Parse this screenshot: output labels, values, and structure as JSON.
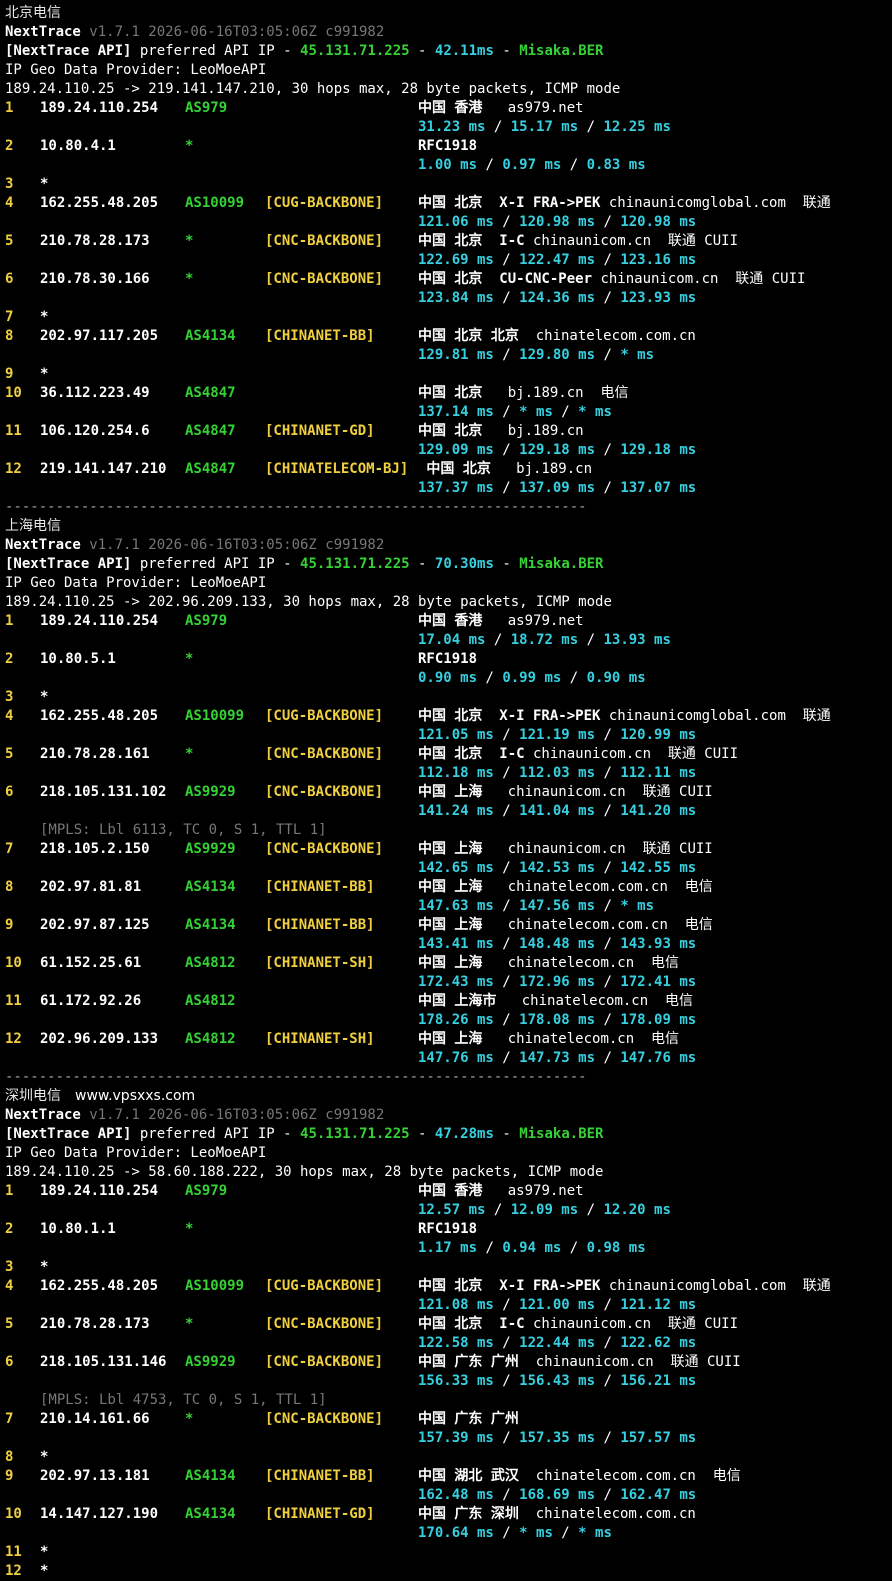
{
  "watermark": "www.vpsxxs.com",
  "sections": [
    {
      "title": "北京电信",
      "nt_name": "NextTrace",
      "nt_version": "v1.7.1 2026-06-16T03:05:06Z c991982",
      "api_label": "[NextTrace API]",
      "api_text": " preferred API IP - ",
      "api_ip": "45.131.71.225",
      "api_dash1": " - ",
      "api_ms": "42.11ms",
      "api_dash2": " - ",
      "api_node": "Misaka.BER",
      "geo_provider": "IP Geo Data Provider: LeoMoeAPI",
      "route_line": "189.24.110.25 -> 219.141.147.210, 30 hops max, 28 byte packets, ICMP mode",
      "hops": [
        {
          "ttl": "1",
          "ip": "189.24.110.254",
          "asn": "AS979",
          "tag": "",
          "geo_b": "中国 香港",
          "host": "   as979.net",
          "lat": [
            "31.23 ms",
            "15.17 ms",
            "12.25 ms"
          ]
        },
        {
          "ttl": "2",
          "ip": "10.80.4.1",
          "asn": "*",
          "tag": "",
          "geo_b": "RFC1918",
          "host": "",
          "lat": [
            "1.00 ms",
            "0.97 ms",
            "0.83 ms"
          ]
        },
        {
          "ttl": "3",
          "ip": "*",
          "star": true
        },
        {
          "ttl": "4",
          "ip": "162.255.48.205",
          "asn": "AS10099",
          "tag": "[CUG-BACKBONE]",
          "geo_b": "中国 北京  X-I FRA->PEK",
          "host": " chinaunicomglobal.com  联通",
          "lat": [
            "121.06 ms",
            "120.98 ms",
            "120.98 ms"
          ]
        },
        {
          "ttl": "5",
          "ip": "210.78.28.173",
          "asn": "*",
          "tag": "[CNC-BACKBONE]",
          "geo_b": "中国 北京  I-C",
          "host": " chinaunicom.cn  联通 CUII",
          "lat": [
            "122.69 ms",
            "122.47 ms",
            "123.16 ms"
          ]
        },
        {
          "ttl": "6",
          "ip": "210.78.30.166",
          "asn": "*",
          "tag": "[CNC-BACKBONE]",
          "geo_b": "中国 北京  CU-CNC-Peer",
          "host": " chinaunicom.cn  联通 CUII",
          "lat": [
            "123.84 ms",
            "124.36 ms",
            "123.93 ms"
          ]
        },
        {
          "ttl": "7",
          "ip": "*",
          "star": true
        },
        {
          "ttl": "8",
          "ip": "202.97.117.205",
          "asn": "AS4134",
          "tag": "[CHINANET-BB]",
          "geo_b": "中国 北京 北京",
          "host": "  chinatelecom.com.cn",
          "lat": [
            "129.81 ms",
            "129.80 ms",
            "* ms"
          ]
        },
        {
          "ttl": "9",
          "ip": "*",
          "star": true
        },
        {
          "ttl": "10",
          "ip": "36.112.223.49",
          "asn": "AS4847",
          "tag": "",
          "geo_b": "中国 北京",
          "host": "   bj.189.cn  电信",
          "lat": [
            "137.14 ms",
            "* ms",
            "* ms"
          ]
        },
        {
          "ttl": "11",
          "ip": "106.120.254.6",
          "asn": "AS4847",
          "tag": "[CHINANET-GD]",
          "geo_b": "中国 北京",
          "host": "   bj.189.cn",
          "lat": [
            "129.09 ms",
            "129.18 ms",
            "129.18 ms"
          ]
        },
        {
          "ttl": "12",
          "ip": "219.141.147.210",
          "asn": "AS4847",
          "tag": "[CHINATELECOM-BJ]",
          "geo_b": " 中国 北京",
          "host": "   bj.189.cn",
          "lat": [
            "137.37 ms",
            "137.09 ms",
            "137.07 ms"
          ]
        }
      ]
    },
    {
      "title": "上海电信",
      "nt_name": "NextTrace",
      "nt_version": "v1.7.1 2026-06-16T03:05:06Z c991982",
      "api_label": "[NextTrace API]",
      "api_text": " preferred API IP - ",
      "api_ip": "45.131.71.225",
      "api_dash1": " - ",
      "api_ms": "70.30ms",
      "api_dash2": " - ",
      "api_node": "Misaka.BER",
      "geo_provider": "IP Geo Data Provider: LeoMoeAPI",
      "route_line": "189.24.110.25 -> 202.96.209.133, 30 hops max, 28 byte packets, ICMP mode",
      "hops": [
        {
          "ttl": "1",
          "ip": "189.24.110.254",
          "asn": "AS979",
          "tag": "",
          "geo_b": "中国 香港",
          "host": "   as979.net",
          "lat": [
            "17.04 ms",
            "18.72 ms",
            "13.93 ms"
          ]
        },
        {
          "ttl": "2",
          "ip": "10.80.5.1",
          "asn": "*",
          "tag": "",
          "geo_b": "RFC1918",
          "host": "",
          "lat": [
            "0.90 ms",
            "0.99 ms",
            "0.90 ms"
          ]
        },
        {
          "ttl": "3",
          "ip": "*",
          "star": true
        },
        {
          "ttl": "4",
          "ip": "162.255.48.205",
          "asn": "AS10099",
          "tag": "[CUG-BACKBONE]",
          "geo_b": "中国 北京  X-I FRA->PEK",
          "host": " chinaunicomglobal.com  联通",
          "lat": [
            "121.05 ms",
            "121.19 ms",
            "120.99 ms"
          ]
        },
        {
          "ttl": "5",
          "ip": "210.78.28.161",
          "asn": "*",
          "tag": "[CNC-BACKBONE]",
          "geo_b": "中国 北京  I-C",
          "host": " chinaunicom.cn  联通 CUII",
          "lat": [
            "112.18 ms",
            "112.03 ms",
            "112.11 ms"
          ]
        },
        {
          "ttl": "6",
          "ip": "218.105.131.102",
          "asn": "AS9929",
          "tag": "[CNC-BACKBONE]",
          "geo_b": "中国 上海",
          "host": "   chinaunicom.cn  联通 CUII",
          "lat": [
            "141.24 ms",
            "141.04 ms",
            "141.20 ms"
          ],
          "mpls": "[MPLS: Lbl 6113, TC 0, S 1, TTL 1]"
        },
        {
          "ttl": "7",
          "ip": "218.105.2.150",
          "asn": "AS9929",
          "tag": "[CNC-BACKBONE]",
          "geo_b": "中国 上海",
          "host": "   chinaunicom.cn  联通 CUII",
          "lat": [
            "142.65 ms",
            "142.53 ms",
            "142.55 ms"
          ]
        },
        {
          "ttl": "8",
          "ip": "202.97.81.81",
          "asn": "AS4134",
          "tag": "[CHINANET-BB]",
          "geo_b": "中国 上海",
          "host": "   chinatelecom.com.cn  电信",
          "lat": [
            "147.63 ms",
            "147.56 ms",
            "* ms"
          ]
        },
        {
          "ttl": "9",
          "ip": "202.97.87.125",
          "asn": "AS4134",
          "tag": "[CHINANET-BB]",
          "geo_b": "中国 上海",
          "host": "   chinatelecom.com.cn  电信",
          "lat": [
            "143.41 ms",
            "148.48 ms",
            "143.93 ms"
          ]
        },
        {
          "ttl": "10",
          "ip": "61.152.25.61",
          "asn": "AS4812",
          "tag": "[CHINANET-SH]",
          "geo_b": "中国 上海",
          "host": "   chinatelecom.cn  电信",
          "lat": [
            "172.43 ms",
            "172.96 ms",
            "172.41 ms"
          ]
        },
        {
          "ttl": "11",
          "ip": "61.172.92.26",
          "asn": "AS4812",
          "tag": "",
          "geo_b": "中国 上海市",
          "host": "   chinatelecom.cn  电信",
          "lat": [
            "178.26 ms",
            "178.08 ms",
            "178.09 ms"
          ]
        },
        {
          "ttl": "12",
          "ip": "202.96.209.133",
          "asn": "AS4812",
          "tag": "[CHINANET-SH]",
          "geo_b": "中国 上海",
          "host": "   chinatelecom.cn  电信",
          "lat": [
            "147.76 ms",
            "147.73 ms",
            "147.76 ms"
          ]
        }
      ]
    },
    {
      "title": "深圳电信",
      "nt_name": "NextTrace",
      "nt_version": "v1.7.1 2026-06-16T03:05:06Z c991982",
      "api_label": "[NextTrace API]",
      "api_text": " preferred API IP - ",
      "api_ip": "45.131.71.225",
      "api_dash1": " - ",
      "api_ms": "47.28ms",
      "api_dash2": " - ",
      "api_node": "Misaka.BER",
      "geo_provider": "IP Geo Data Provider: LeoMoeAPI",
      "route_line": "189.24.110.25 -> 58.60.188.222, 30 hops max, 28 byte packets, ICMP mode",
      "hops": [
        {
          "ttl": "1",
          "ip": "189.24.110.254",
          "asn": "AS979",
          "tag": "",
          "geo_b": "中国 香港",
          "host": "   as979.net",
          "lat": [
            "12.57 ms",
            "12.09 ms",
            "12.20 ms"
          ]
        },
        {
          "ttl": "2",
          "ip": "10.80.1.1",
          "asn": "*",
          "tag": "",
          "geo_b": "RFC1918",
          "host": "",
          "lat": [
            "1.17 ms",
            "0.94 ms",
            "0.98 ms"
          ]
        },
        {
          "ttl": "3",
          "ip": "*",
          "star": true
        },
        {
          "ttl": "4",
          "ip": "162.255.48.205",
          "asn": "AS10099",
          "tag": "[CUG-BACKBONE]",
          "geo_b": "中国 北京  X-I FRA->PEK",
          "host": " chinaunicomglobal.com  联通",
          "lat": [
            "121.08 ms",
            "121.00 ms",
            "121.12 ms"
          ]
        },
        {
          "ttl": "5",
          "ip": "210.78.28.173",
          "asn": "*",
          "tag": "[CNC-BACKBONE]",
          "geo_b": "中国 北京  I-C",
          "host": " chinaunicom.cn  联通 CUII",
          "lat": [
            "122.58 ms",
            "122.44 ms",
            "122.62 ms"
          ]
        },
        {
          "ttl": "6",
          "ip": "218.105.131.146",
          "asn": "AS9929",
          "tag": "[CNC-BACKBONE]",
          "geo_b": "中国 广东 广州",
          "host": "  chinaunicom.cn  联通 CUII",
          "lat": [
            "156.33 ms",
            "156.43 ms",
            "156.21 ms"
          ],
          "mpls": "[MPLS: Lbl 4753, TC 0, S 1, TTL 1]"
        },
        {
          "ttl": "7",
          "ip": "210.14.161.66",
          "asn": "*",
          "tag": "[CNC-BACKBONE]",
          "geo_b": "中国 广东 广州",
          "host": "",
          "lat": [
            "157.39 ms",
            "157.35 ms",
            "157.57 ms"
          ]
        },
        {
          "ttl": "8",
          "ip": "*",
          "star": true
        },
        {
          "ttl": "9",
          "ip": "202.97.13.181",
          "asn": "AS4134",
          "tag": "[CHINANET-BB]",
          "geo_b": "中国 湖北 武汉",
          "host": "  chinatelecom.com.cn  电信",
          "lat": [
            "162.48 ms",
            "168.69 ms",
            "162.47 ms"
          ]
        },
        {
          "ttl": "10",
          "ip": "14.147.127.190",
          "asn": "AS4134",
          "tag": "[CHINANET-GD]",
          "geo_b": "中国 广东 深圳",
          "host": "  chinatelecom.com.cn",
          "lat": [
            "170.64 ms",
            "* ms",
            "* ms"
          ]
        },
        {
          "ttl": "11",
          "ip": "*",
          "star": true
        },
        {
          "ttl": "12",
          "ip": "*",
          "star": true
        }
      ]
    }
  ],
  "separator": "---------------------------------------------------------------------",
  "latency_sep": " / "
}
